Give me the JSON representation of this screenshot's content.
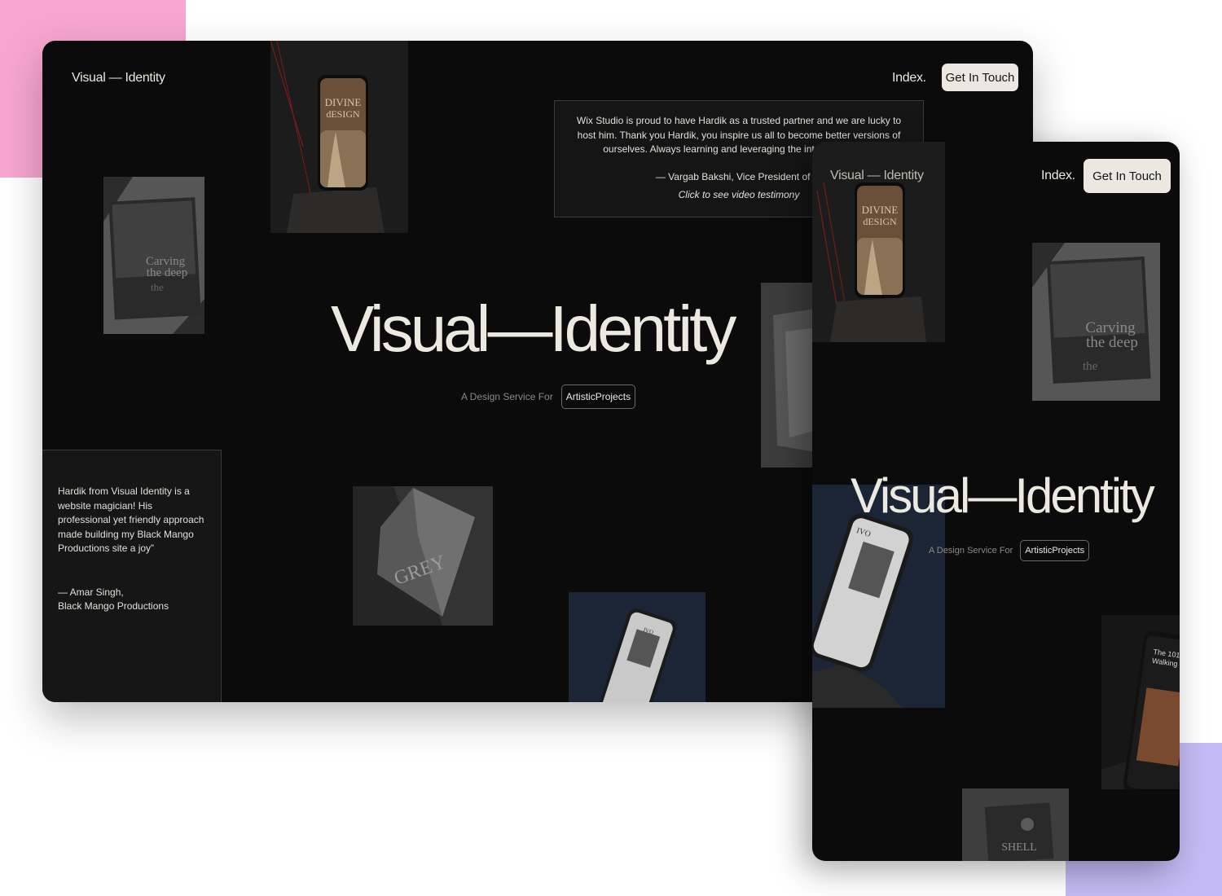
{
  "desktop": {
    "brand": "Visual — Identity",
    "nav_link": "Index.",
    "cta_label": "Get In Touch",
    "testimonial_top": {
      "quote": "Wix Studio is proud to have Hardik as a trusted partner and we are lucky to host him. Thank you Hardik, you inspire us all to become better versions of ourselves. Always learning and leveraging the internet to do go",
      "author": "— Vargab Bakshi, Vice President of W",
      "video_link": "Click to see video testimony"
    },
    "hero_title": "Visual—Identity",
    "hero_subtitle": "A Design Service For",
    "hero_pill": "ArtisticProjects",
    "testimonial_side": {
      "quote": "Hardik from Visual Identity is a website magician! His professional yet friendly approach made building my Black Mango Productions site a joy”",
      "author_name": "— Amar Singh,",
      "author_company": "Black Mango Productions"
    },
    "images": {
      "phone_title_line1": "DIVINE",
      "phone_title_line2": "dESIGN",
      "book_line1": "Carving",
      "book_line2": "the deep",
      "book_line3": "the",
      "grey_book": "GREY",
      "phone2_brand": "IVO"
    }
  },
  "mobile": {
    "brand": "Visual — Identity",
    "nav_link": "Index.",
    "cta_label": "Get In Touch",
    "hero_title": "Visual—Identity",
    "hero_subtitle": "A Design Service For",
    "hero_pill": "ArtisticProjects",
    "images": {
      "phone_title_line1": "DIVINE",
      "phone_title_line2": "dESIGN",
      "book_line1": "Carving",
      "book_line2": "the deep",
      "book_line3": "the",
      "phone2_brand": "IVO",
      "phone3_line1": "The 101",
      "phone3_line2": "Walking Wiz",
      "shell": "SHELL"
    }
  },
  "colors": {
    "background": "#0b0b0b",
    "text": "#ece9e1",
    "cta": "#ebe8e1",
    "deco_pink": "#f7a6cf",
    "deco_lavender": "#c4baf4"
  }
}
